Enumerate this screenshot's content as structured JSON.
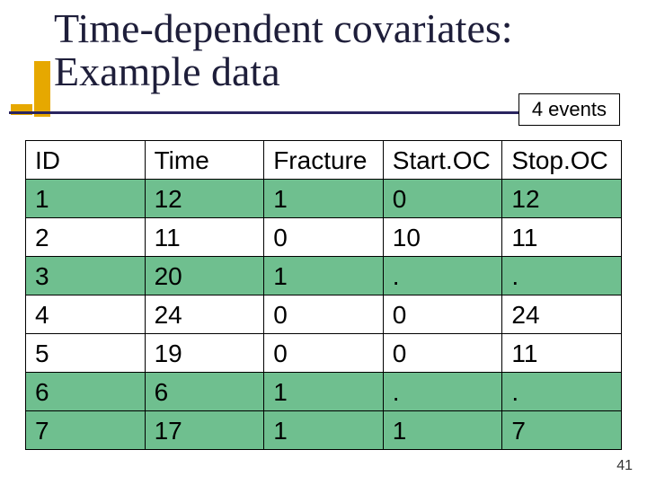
{
  "title": {
    "line1": "Time-dependent covariates:",
    "line2": "Example data"
  },
  "callout": "4 events",
  "table": {
    "headers": [
      "ID",
      "Time",
      "Fracture",
      "Start.OC",
      "Stop.OC"
    ],
    "rows": [
      {
        "cells": [
          "1",
          "12",
          "1",
          "0",
          "12"
        ],
        "highlight": true
      },
      {
        "cells": [
          "2",
          "11",
          "0",
          "10",
          "11"
        ],
        "highlight": false
      },
      {
        "cells": [
          "3",
          "20",
          "1",
          ".",
          "."
        ],
        "highlight": true
      },
      {
        "cells": [
          "4",
          "24",
          "0",
          "0",
          "24"
        ],
        "highlight": false
      },
      {
        "cells": [
          "5",
          "19",
          "0",
          "0",
          "11"
        ],
        "highlight": false
      },
      {
        "cells": [
          "6",
          "6",
          "1",
          ".",
          "."
        ],
        "highlight": true
      },
      {
        "cells": [
          "7",
          "17",
          "1",
          "1",
          "7"
        ],
        "highlight": true
      }
    ]
  },
  "page_number": "41"
}
